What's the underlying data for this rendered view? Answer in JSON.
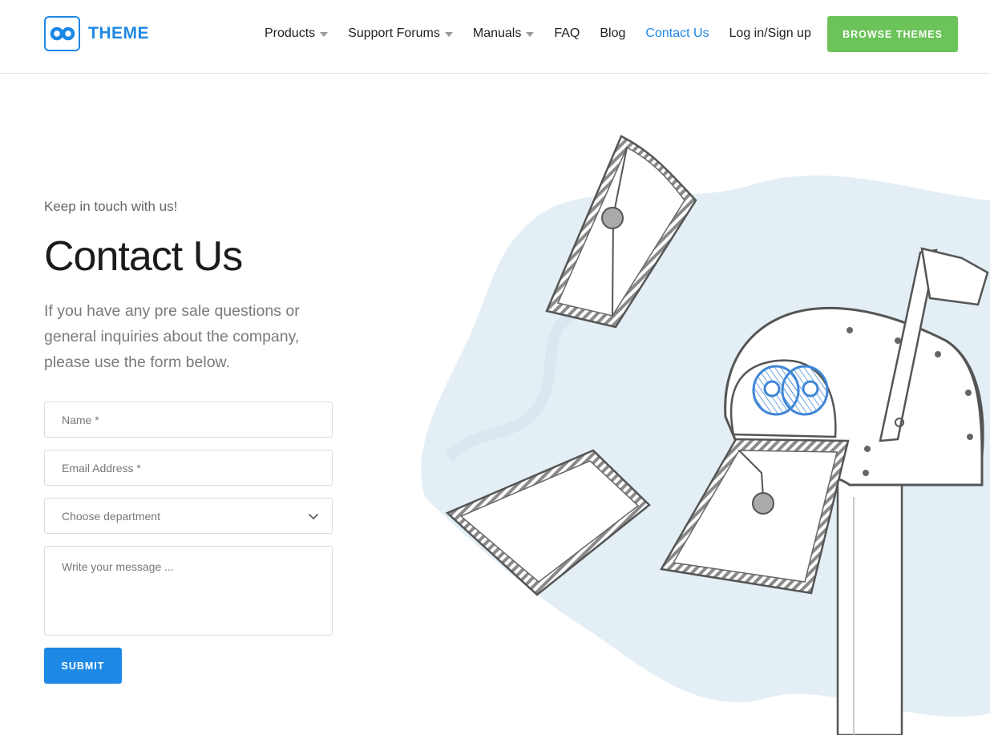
{
  "header": {
    "logo_text": "THEME",
    "nav": [
      {
        "label": "Products",
        "has_dropdown": true
      },
      {
        "label": "Support Forums",
        "has_dropdown": true
      },
      {
        "label": "Manuals",
        "has_dropdown": true
      },
      {
        "label": "FAQ",
        "has_dropdown": false
      },
      {
        "label": "Blog",
        "has_dropdown": false
      },
      {
        "label": "Contact Us",
        "has_dropdown": false,
        "active": true
      },
      {
        "label": "Log in/Sign up",
        "has_dropdown": false
      }
    ],
    "browse_label": "BROWSE THEMES"
  },
  "contact": {
    "eyebrow": "Keep in touch with us!",
    "title": "Contact Us",
    "intro": "If you have any pre sale questions or general inquiries about the company, please use the form below."
  },
  "form": {
    "name_placeholder": "Name *",
    "email_placeholder": "Email Address *",
    "department_placeholder": "Choose department",
    "message_placeholder": "Write your message ...",
    "submit_label": "SUBMIT"
  },
  "colors": {
    "accent_blue": "#1e88e5",
    "browse_green": "#6cc35a",
    "illustration_wash": "#e3eef5"
  },
  "icons": {
    "logo": "infinity-logo-icon",
    "dropdown": "caret-down-icon",
    "select": "chevron-down-icon",
    "illustration": "mailbox-letters-illustration"
  }
}
